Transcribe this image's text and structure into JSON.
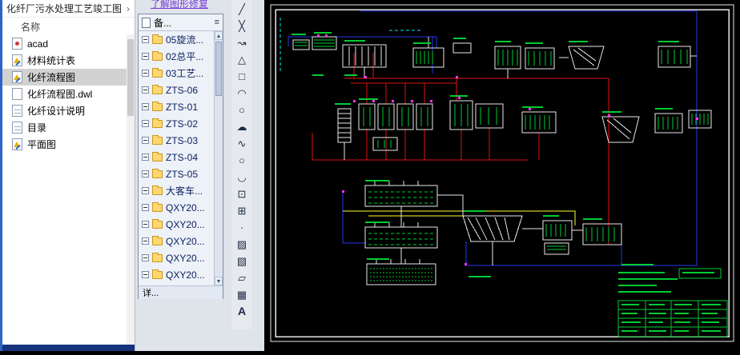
{
  "accent_colors": {
    "canvas_bg": "#000000",
    "frame_white": "#e8e8e8",
    "pipe_red": "#e01212",
    "pipe_blue": "#2438e8",
    "pipe_yellow": "#ffff2e",
    "pipe_cyan": "#00e5ff",
    "detail_green": "#00cc33",
    "dot_magenta": "#ff35ff",
    "selection_gray": "#d2d2d2",
    "link_purple": "#7a3bd6"
  },
  "message_bar": {
    "repair_link": "了解图形修复"
  },
  "explorer": {
    "breadcrumb": "化纤厂污水处理工艺竣工图",
    "chevron": "›",
    "name_header": "名称",
    "items": [
      {
        "label": "acad",
        "icon": "acad",
        "selected": false
      },
      {
        "label": "材料统计表",
        "icon": "dwg",
        "selected": false
      },
      {
        "label": "化纤流程图",
        "icon": "dwg",
        "selected": true
      },
      {
        "label": "化纤流程图.dwl",
        "icon": "dwl",
        "selected": false
      },
      {
        "label": "化纤设计说明",
        "icon": "doc",
        "selected": false
      },
      {
        "label": "目录",
        "icon": "doc",
        "selected": false
      },
      {
        "label": "平面图",
        "icon": "dwg",
        "selected": false
      }
    ]
  },
  "palette": {
    "header": "备...",
    "menu_icon": "≡",
    "scroll_up": "▲",
    "scroll_down": "▼",
    "items": [
      "05旋流...",
      "02总平...",
      "03工艺...",
      "ZTS-06",
      "ZTS-01",
      "ZTS-02",
      "ZTS-03",
      "ZTS-04",
      "ZTS-05",
      "大客车...",
      "QXY20...",
      "QXY20...",
      "QXY20...",
      "QXY20...",
      "QXY20..."
    ],
    "footer": "详..."
  },
  "toolbar": {
    "tools": [
      {
        "name": "line",
        "glyph": "╱"
      },
      {
        "name": "construction-line",
        "glyph": "╳"
      },
      {
        "name": "polyline",
        "glyph": "↝"
      },
      {
        "name": "polygon",
        "glyph": "△"
      },
      {
        "name": "rectangle",
        "glyph": "□"
      },
      {
        "name": "arc",
        "glyph": "◠"
      },
      {
        "name": "circle",
        "glyph": "○"
      },
      {
        "name": "revision-cloud",
        "glyph": "☁"
      },
      {
        "name": "spline",
        "glyph": "∿"
      },
      {
        "name": "ellipse",
        "glyph": "○"
      },
      {
        "name": "ellipse-arc",
        "glyph": "◡"
      },
      {
        "name": "insert-block",
        "glyph": "⊡"
      },
      {
        "name": "make-block",
        "glyph": "⊞"
      },
      {
        "name": "point",
        "glyph": "∙"
      },
      {
        "name": "hatch",
        "glyph": "▨"
      },
      {
        "name": "gradient",
        "glyph": "▧"
      },
      {
        "name": "region",
        "glyph": "▱"
      },
      {
        "name": "table",
        "glyph": "▦"
      },
      {
        "name": "mtext",
        "glyph": "A"
      }
    ]
  }
}
